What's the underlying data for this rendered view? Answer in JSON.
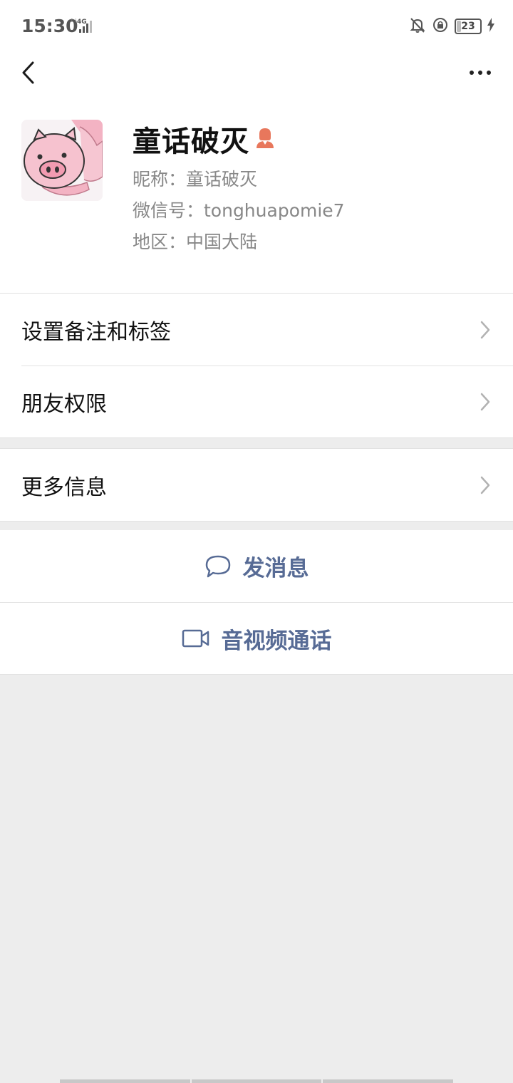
{
  "status_bar": {
    "time": "15:30",
    "network": "4G",
    "battery_level": "23",
    "icons": [
      "signal-icon",
      "bell-off-icon",
      "rotation-lock-icon",
      "battery-icon",
      "charging-icon"
    ]
  },
  "nav": {
    "back_icon": "chevron-left-icon",
    "more_icon": "more-dots-icon"
  },
  "profile": {
    "display_name": "童话破灭",
    "gender_icon": "female-user-icon",
    "nickname": "昵称：童话破灭",
    "wechat_id": "微信号：tonghuapomie7",
    "region": "地区：中国大陆"
  },
  "menu": {
    "items": [
      {
        "label": "设置备注和标签"
      },
      {
        "label": "朋友权限"
      }
    ],
    "more_info": "更多信息"
  },
  "actions": {
    "send_message": "发消息",
    "video_call": "音视频通话"
  },
  "colors": {
    "link_blue": "#576b95",
    "page_bg": "#ededed",
    "badge_orange": "#e8775c"
  }
}
